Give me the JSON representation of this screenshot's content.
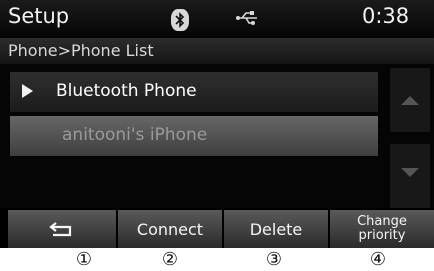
{
  "status_bar": {
    "title": "Setup",
    "clock": "0:38",
    "icons": [
      "bluetooth-icon",
      "usb-icon"
    ]
  },
  "breadcrumb": "Phone>Phone List",
  "list": {
    "items": [
      {
        "label": "Bluetooth Phone",
        "icon": "play-arrow-icon"
      },
      {
        "label": "anitooni's iPhone"
      }
    ]
  },
  "scroll": {
    "up_icon": "chevron-up-icon",
    "down_icon": "chevron-down-icon"
  },
  "softkeys": {
    "back_icon": "back-arrow-icon",
    "connect": "Connect",
    "delete": "Delete",
    "change_priority": "Change\npriority"
  },
  "callouts": [
    "①",
    "②",
    "③",
    "④"
  ],
  "colors": {
    "background": "#000000",
    "text": "#ffffff",
    "dim_text": "#9a9a9a"
  }
}
